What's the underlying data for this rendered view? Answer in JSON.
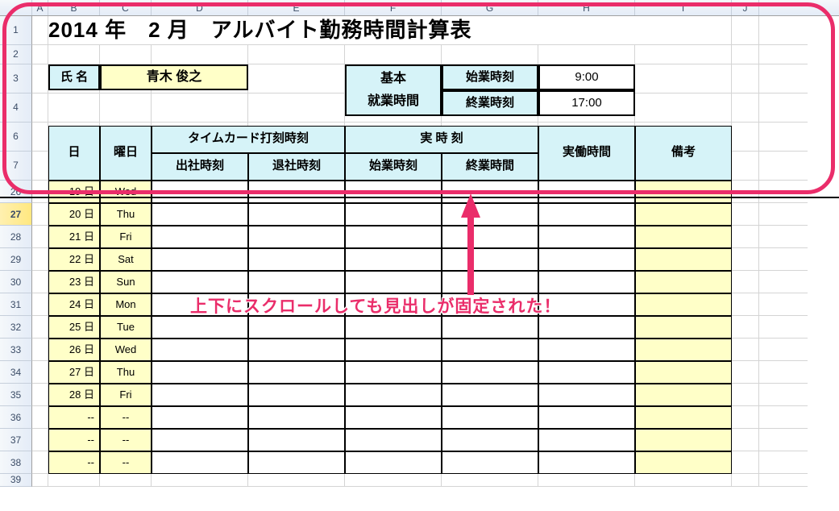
{
  "columns": [
    "",
    "A",
    "B",
    "C",
    "D",
    "E",
    "F",
    "G",
    "H",
    "I",
    "J"
  ],
  "row_nums_top": [
    "1",
    "2",
    "3",
    "4",
    "6",
    "7"
  ],
  "row_nums_bottom": [
    "26",
    "27",
    "28",
    "29",
    "30",
    "31",
    "32",
    "33",
    "34",
    "35",
    "36",
    "37",
    "38",
    "39"
  ],
  "selected_row": "27",
  "title": "2014 年　2 月　アルバイト勤務時間計算表",
  "name_label": "氏 名",
  "name_value": "青木 俊之",
  "base_label_1": "基本",
  "base_label_2": "就業時間",
  "start_label": "始業時刻",
  "end_label": "終業時刻",
  "start_time": "9:00",
  "end_time": "17:00",
  "headers": {
    "day": "日",
    "weekday": "曜日",
    "timecard_group": "タイムカード打刻時刻",
    "timecard_in": "出社時刻",
    "timecard_out": "退社時刻",
    "actual_group": "実 時 刻",
    "actual_start": "始業時刻",
    "actual_end": "終業時間",
    "work_hours": "実働時間",
    "remarks": "備考"
  },
  "rows": [
    {
      "day": "19 日",
      "wd": "Wed"
    },
    {
      "day": "20 日",
      "wd": "Thu"
    },
    {
      "day": "21 日",
      "wd": "Fri"
    },
    {
      "day": "22 日",
      "wd": "Sat"
    },
    {
      "day": "23 日",
      "wd": "Sun"
    },
    {
      "day": "24 日",
      "wd": "Mon"
    },
    {
      "day": "25 日",
      "wd": "Tue"
    },
    {
      "day": "26 日",
      "wd": "Wed"
    },
    {
      "day": "27 日",
      "wd": "Thu"
    },
    {
      "day": "28 日",
      "wd": "Fri"
    },
    {
      "day": "--",
      "wd": "--"
    },
    {
      "day": "--",
      "wd": "--"
    },
    {
      "day": "--",
      "wd": "--"
    }
  ],
  "annotation": "上下にスクロールしても見出しが固定された！"
}
